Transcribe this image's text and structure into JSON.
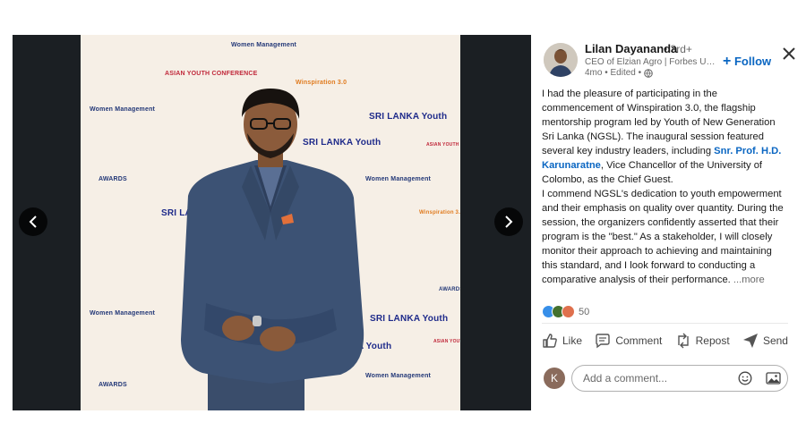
{
  "post": {
    "author_name": "Lilan Dayananda",
    "degree": "• 3rd+",
    "headline": "CEO of Elzian Agro | Forbes Unde...",
    "time": "4mo • Edited •",
    "follow_label": "Follow",
    "text_p1_a": "I had the pleasure of participating in the commencement of Winspiration 3.0, the flagship mentorship program led by Youth of New Generation Sri Lanka (NGSL). The inaugural session featured several key industry leaders, including ",
    "mention": "Snr. Prof. H.D. Karunaratne",
    "text_p1_b": ", Vice Chancellor of the University of Colombo, as the Chief Guest.",
    "text_p2": "I commend NGSL's dedication to youth empowerment and their emphasis on quality over quantity. During the session, the organizers confidently asserted that their program is the \"best.\" As a stakeholder, I will closely monitor their approach to achieving and maintaining this standard, and I look forward to conducting a comparative analysis of their performance.",
    "more_label": "...more",
    "reaction_count": "50"
  },
  "actions": {
    "like": "Like",
    "comment": "Comment",
    "repost": "Repost",
    "send": "Send"
  },
  "comment": {
    "avatar_initial": "K",
    "placeholder": "Add a comment..."
  },
  "backdrop_logos": [
    "SRI LANKA Youth",
    "Women Management",
    "ASIAN YOUTH CONFERENCE",
    "Winspiration 3.0",
    "AWARDS"
  ],
  "colors": {
    "accent": "#0a66c2",
    "viewer_bg": "#1b1f23",
    "backdrop": "#f6efe6"
  },
  "icons": {
    "prev": "chevron-left-icon",
    "next": "chevron-right-icon",
    "close": "close-icon",
    "globe": "globe-icon",
    "like": "thumbs-up-icon",
    "comment": "speech-bubble-icon",
    "repost": "repost-icon",
    "send": "paper-plane-icon",
    "emoji": "emoji-icon",
    "image": "image-icon"
  }
}
